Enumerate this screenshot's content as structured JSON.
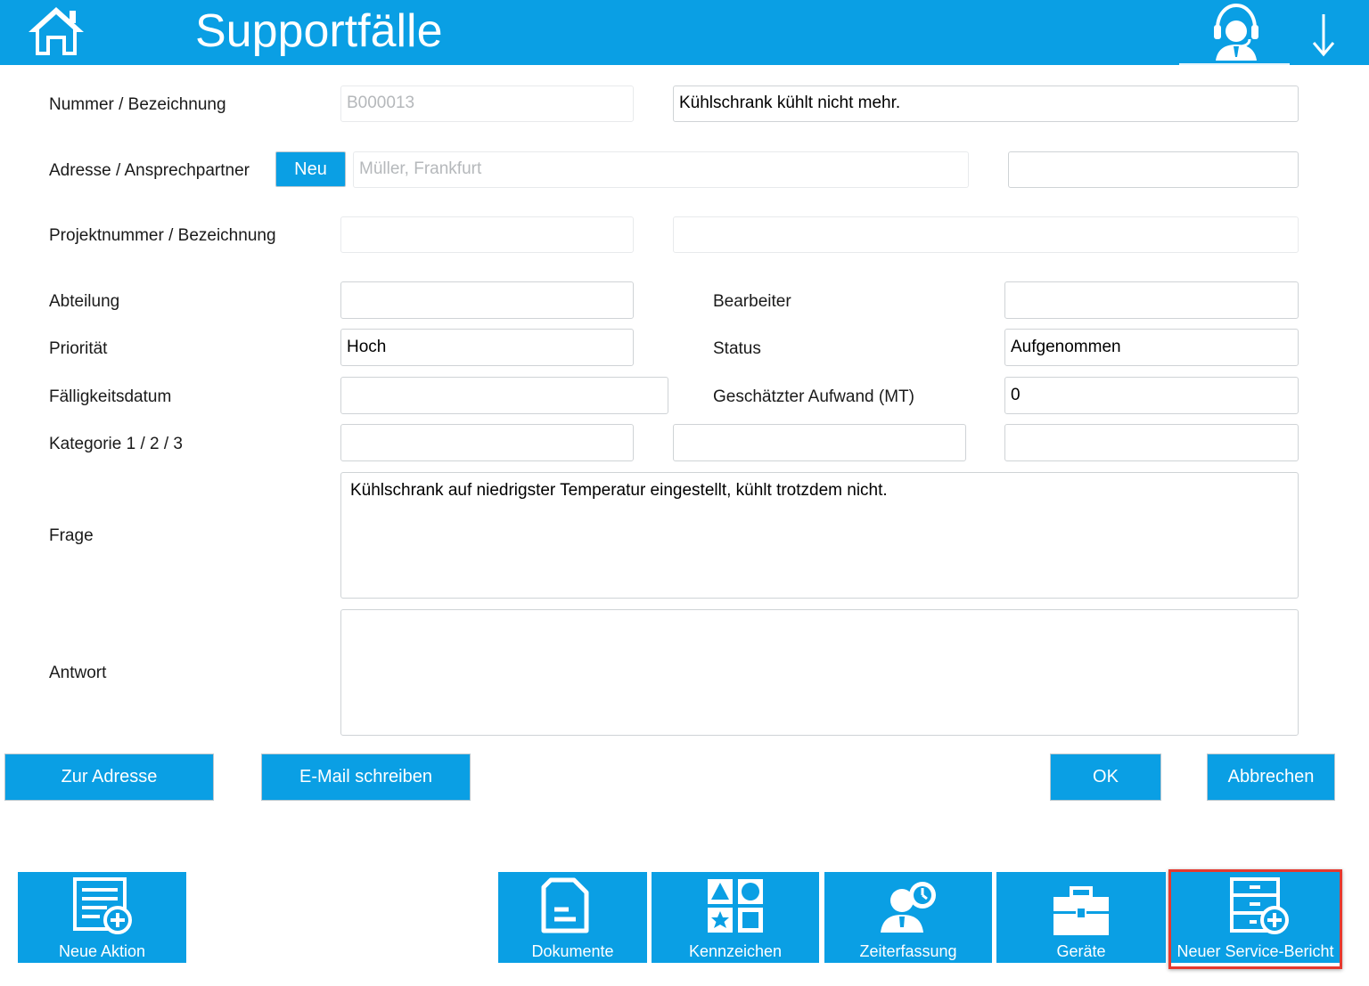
{
  "header": {
    "title": "Supportfälle",
    "home_icon": "home-icon",
    "support_icon": "support-agent-icon",
    "arrow_icon": "arrow-down-icon",
    "color": "#0a9fe4"
  },
  "form": {
    "nummer_label": "Nummer / Bezeichnung",
    "nummer_value": "B000013",
    "bezeichnung_value": "Kühlschrank kühlt nicht mehr.",
    "adresse_label": "Adresse / Ansprechpartner",
    "neu_button": "Neu",
    "adresse_value": "Müller, Frankfurt",
    "ansprechpartner_value": "",
    "projekt_label": "Projektnummer / Bezeichnung",
    "projekt_nummer_value": "",
    "projekt_bezeichnung_value": "",
    "abteilung_label": "Abteilung",
    "abteilung_value": "",
    "bearbeiter_label": "Bearbeiter",
    "bearbeiter_value": "",
    "prioritaet_label": "Priorität",
    "prioritaet_value": "Hoch",
    "status_label": "Status",
    "status_value": "Aufgenommen",
    "faelligkeit_label": "Fälligkeitsdatum",
    "faelligkeit_value": "",
    "aufwand_label": "Geschätzter Aufwand (MT)",
    "aufwand_value": "0",
    "kategorie_label": "Kategorie 1 / 2 / 3",
    "kategorie1_value": "",
    "kategorie2_value": "",
    "kategorie3_value": "",
    "frage_label": "Frage",
    "frage_value": "Kühlschrank auf niedrigster Temperatur eingestellt, kühlt trotzdem nicht.",
    "antwort_label": "Antwort",
    "antwort_value": ""
  },
  "actions": {
    "zur_adresse": "Zur Adresse",
    "email": "E-Mail schreiben",
    "ok": "OK",
    "abbrechen": "Abbrechen"
  },
  "toolbar": {
    "neue_aktion": "Neue Aktion",
    "dokumente": "Dokumente",
    "kennzeichen": "Kennzeichen",
    "zeiterfassung": "Zeiterfassung",
    "geraete": "Geräte",
    "neuer_service_bericht": "Neuer Service-Bericht",
    "highlight_color": "#e5392f"
  }
}
